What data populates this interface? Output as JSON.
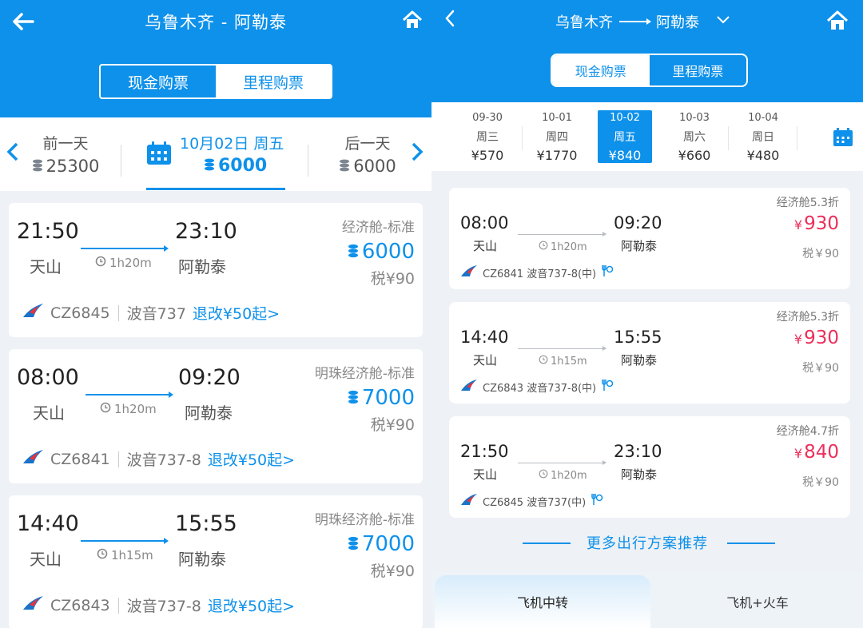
{
  "left": {
    "header": {
      "title": "乌鲁木齐 - 阿勒泰"
    },
    "segment": {
      "cash": "现金购票",
      "miles": "里程购票"
    },
    "datebar": {
      "prev_label": "前一天",
      "prev_points": "25300",
      "current_date": "10月02日 周五",
      "current_points": "6000",
      "next_label": "后一天",
      "next_points": "6000"
    },
    "flights": [
      {
        "dep_time": "21:50",
        "arr_time": "23:10",
        "dep_airport": "天山",
        "arr_airport": "阿勒泰",
        "duration": "1h20m",
        "cabin": "经济舱-标准",
        "points": "6000",
        "tax": "税¥90",
        "flight_no": "CZ6845",
        "aircraft": "波音737",
        "refund": "退改¥50起>"
      },
      {
        "dep_time": "08:00",
        "arr_time": "09:20",
        "dep_airport": "天山",
        "arr_airport": "阿勒泰",
        "duration": "1h20m",
        "cabin": "明珠经济舱-标准",
        "points": "7000",
        "tax": "税¥90",
        "flight_no": "CZ6841",
        "aircraft": "波音737-8",
        "refund": "退改¥50起>"
      },
      {
        "dep_time": "14:40",
        "arr_time": "15:55",
        "dep_airport": "天山",
        "arr_airport": "阿勒泰",
        "duration": "1h15m",
        "cabin": "明珠经济舱-标准",
        "points": "7000",
        "tax": "税¥90",
        "flight_no": "CZ6843",
        "aircraft": "波音737-8",
        "refund": "退改¥50起>"
      }
    ]
  },
  "right": {
    "header": {
      "origin": "乌鲁木齐",
      "destination": "阿勒泰"
    },
    "segment": {
      "cash": "现金购票",
      "miles": "里程购票"
    },
    "dates": [
      {
        "date": "09-30",
        "weekday": "周三",
        "price": "¥570"
      },
      {
        "date": "10-01",
        "weekday": "周四",
        "price": "¥1770"
      },
      {
        "date": "10-02",
        "weekday": "周五",
        "price": "¥840"
      },
      {
        "date": "10-03",
        "weekday": "周六",
        "price": "¥660"
      },
      {
        "date": "10-04",
        "weekday": "周日",
        "price": "¥480"
      }
    ],
    "flights": [
      {
        "dep_time": "08:00",
        "arr_time": "09:20",
        "dep_airport": "天山",
        "arr_airport": "阿勒泰",
        "duration": "1h20m",
        "discount": "经济舱5.3折",
        "currency": "¥",
        "price": "930",
        "tax": "税￥90",
        "flight_info": "CZ6841 波音737-8(中)"
      },
      {
        "dep_time": "14:40",
        "arr_time": "15:55",
        "dep_airport": "天山",
        "arr_airport": "阿勒泰",
        "duration": "1h15m",
        "discount": "经济舱5.3折",
        "currency": "¥",
        "price": "930",
        "tax": "税￥90",
        "flight_info": "CZ6843 波音737-8(中)"
      },
      {
        "dep_time": "21:50",
        "arr_time": "23:10",
        "dep_airport": "天山",
        "arr_airport": "阿勒泰",
        "duration": "1h20m",
        "discount": "经济舱4.7折",
        "currency": "¥",
        "price": "840",
        "tax": "税￥90",
        "flight_info": "CZ6845 波音737(中)"
      }
    ],
    "more_text": "更多出行方案推荐",
    "bottom_tabs": {
      "transfer": "飞机中转",
      "plane_train": "飞机+火车"
    }
  },
  "colors": {
    "brand_blue": "#0e91ea",
    "price_red": "#ee2e5a"
  },
  "icons": [
    "back-arrow-icon",
    "home-icon",
    "calendar-icon",
    "coin-icon",
    "clock-icon",
    "airline-logo-icon",
    "chevron-down-icon",
    "meal-icon"
  ]
}
